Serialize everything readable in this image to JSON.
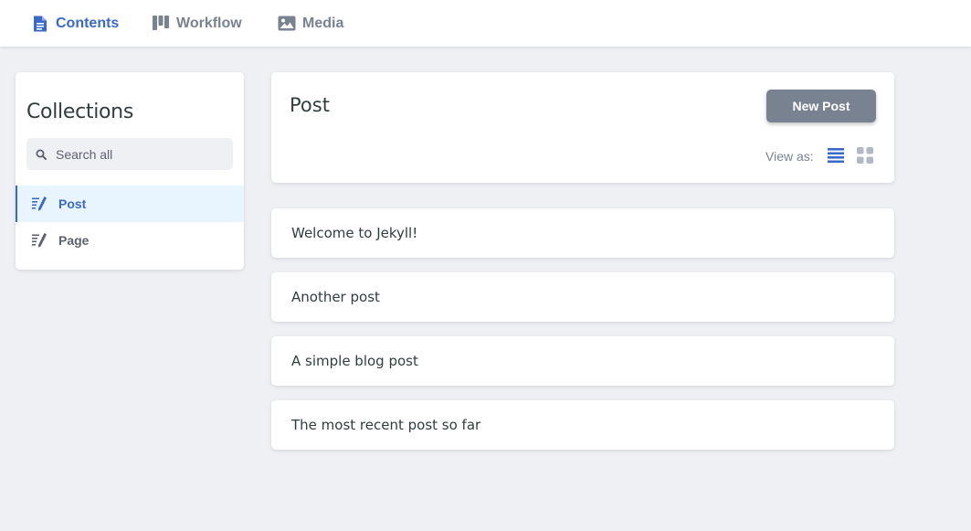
{
  "nav": {
    "items": [
      {
        "label": "Contents",
        "icon": "document-icon",
        "active": true
      },
      {
        "label": "Workflow",
        "icon": "kanban-icon",
        "active": false
      },
      {
        "label": "Media",
        "icon": "image-icon",
        "active": false
      }
    ]
  },
  "sidebar": {
    "title": "Collections",
    "search_placeholder": "Search all",
    "items": [
      {
        "label": "Post",
        "icon": "write-icon",
        "active": true
      },
      {
        "label": "Page",
        "icon": "write-icon",
        "active": false
      }
    ]
  },
  "collection": {
    "title": "Post",
    "new_button_label": "New Post",
    "view_as_label": "View as:",
    "view_mode": "list"
  },
  "entries": [
    {
      "title": "Welcome to Jekyll!"
    },
    {
      "title": "Another post"
    },
    {
      "title": "A simple blog post"
    },
    {
      "title": "The most recent post so far"
    }
  ],
  "colors": {
    "accent": "#3a69c7",
    "muted": "#798291",
    "background": "#eff0f4",
    "active_bg": "#e8f5fe"
  }
}
